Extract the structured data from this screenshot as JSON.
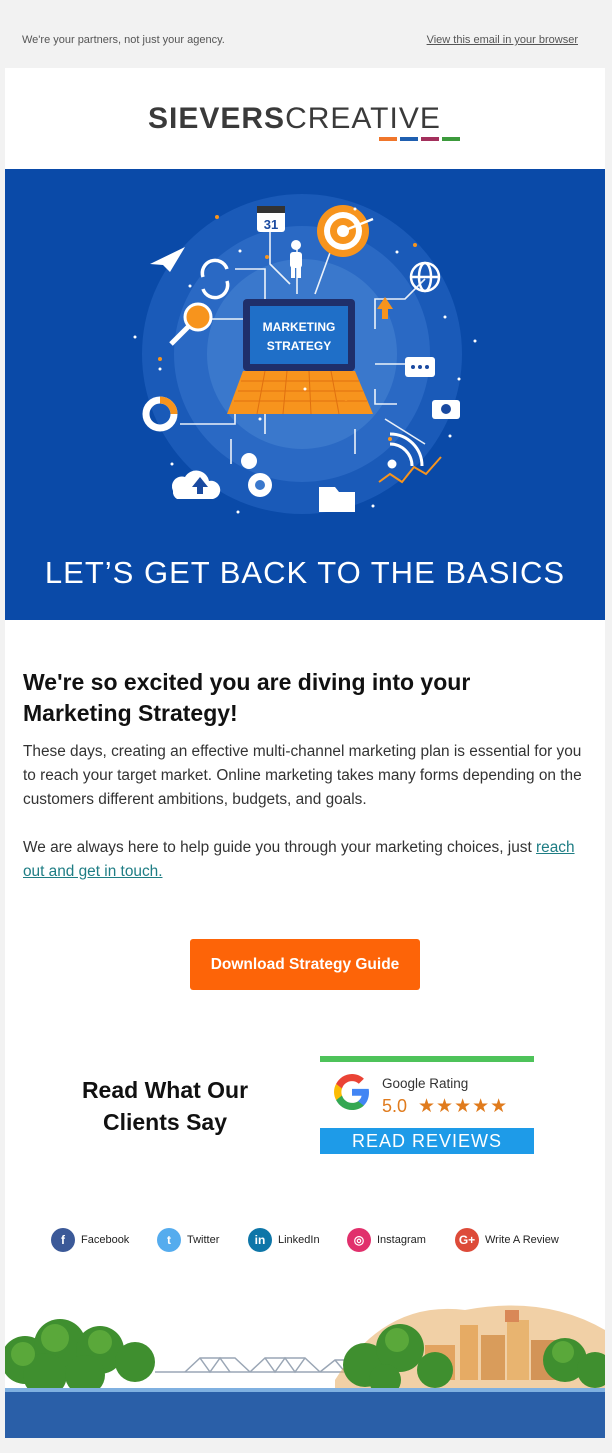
{
  "preheader": {
    "tagline": "We're your partners, not just your agency.",
    "view_in_browser": "View this email in your browser"
  },
  "logo": {
    "bold": "SIEVERS",
    "light": "CREATIVE",
    "bar_colors": [
      "#f0762b",
      "#1f5fb0",
      "#a3305c",
      "#3c9a3c"
    ]
  },
  "hero": {
    "screen_line1": "MARKETING",
    "screen_line2": "STRATEGY",
    "calendar_day": "31",
    "caption": "LET’S GET BACK TO THE BASICS",
    "colors": {
      "background": "#0a4aa8",
      "accent": "#f7941d"
    }
  },
  "content": {
    "headline": "We're so excited you are diving into your Marketing Strategy!",
    "para1": "These days, creating an effective multi-channel marketing plan is essential for you to reach your target market. Online marketing takes many forms depending on the customers different ambitions, budgets, and goals.",
    "para2_prefix": "We are always here to help guide you through your marketing choices, just ",
    "para2_link": "reach out  and get in touch."
  },
  "cta": {
    "label": "Download Strategy Guide",
    "color": "#fd6408"
  },
  "testimonials": {
    "heading": "Read What Our Clients Say",
    "rating_title": "Google Rating",
    "rating_score": "5.0",
    "stars": "★★★★★",
    "stars_value": 5,
    "read_reviews": "READ REVIEWS"
  },
  "social": [
    {
      "label": "Facebook",
      "icon": "facebook-icon",
      "glyph": "f",
      "color": "#3b5998"
    },
    {
      "label": "Twitter",
      "icon": "twitter-icon",
      "glyph": "t",
      "color": "#55acee"
    },
    {
      "label": "LinkedIn",
      "icon": "linkedin-icon",
      "glyph": "in",
      "color": "#0e76a8"
    },
    {
      "label": "Instagram",
      "icon": "instagram-icon",
      "glyph": "◎",
      "color": "#e1306c"
    },
    {
      "label": "Write A Review",
      "icon": "google-plus-icon",
      "glyph": "G+",
      "color": "#dd4b39"
    }
  ]
}
